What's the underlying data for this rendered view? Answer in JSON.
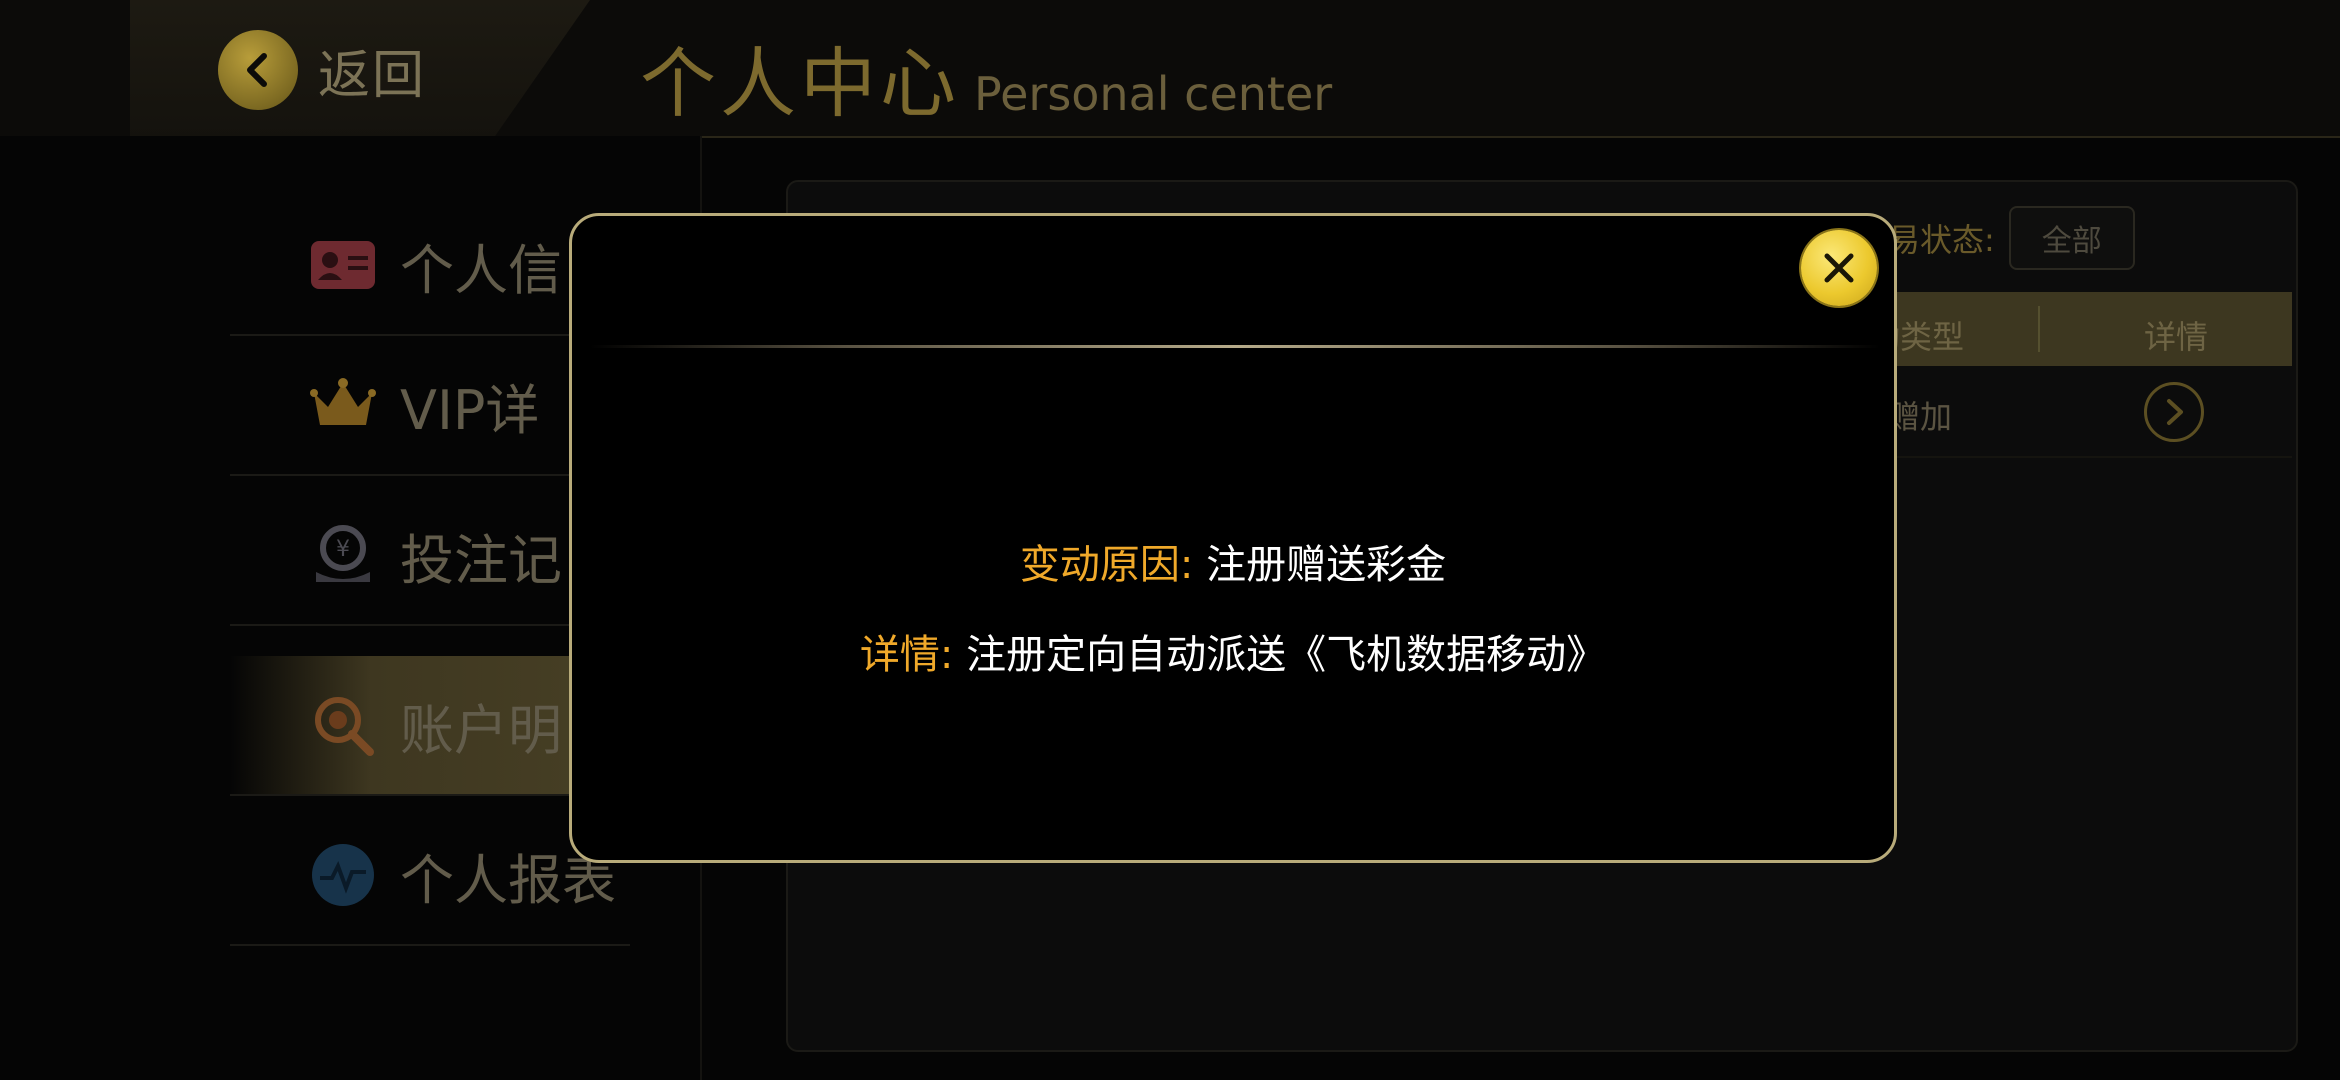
{
  "header": {
    "back_label": "返回",
    "title_cn": "个人中心",
    "title_en": "Personal center"
  },
  "sidebar": {
    "items": [
      {
        "label": "个人信",
        "icon": "id-card-icon"
      },
      {
        "label": "VIP详",
        "icon": "crown-icon"
      },
      {
        "label": "投注记",
        "icon": "bet-record-icon"
      },
      {
        "label": "账户明",
        "icon": "account-detail-icon",
        "active": true
      },
      {
        "label": "个人报表",
        "icon": "report-chart-icon"
      }
    ]
  },
  "filters": {
    "status_label": "易状态:",
    "status_value": "全部"
  },
  "table": {
    "headers": {
      "type": "动类型",
      "detail": "详情"
    },
    "rows": [
      {
        "type": "赠加"
      }
    ]
  },
  "modal": {
    "reason_label": "变动原因:",
    "reason_value": "注册赠送彩金",
    "detail_label": "详情:",
    "detail_value": "注册定向自动派送《飞机数据移动》"
  },
  "colors": {
    "accent_gold": "#f0a92a",
    "modal_border": "#b8ab7a",
    "close_yellow": "#ecc92e"
  }
}
